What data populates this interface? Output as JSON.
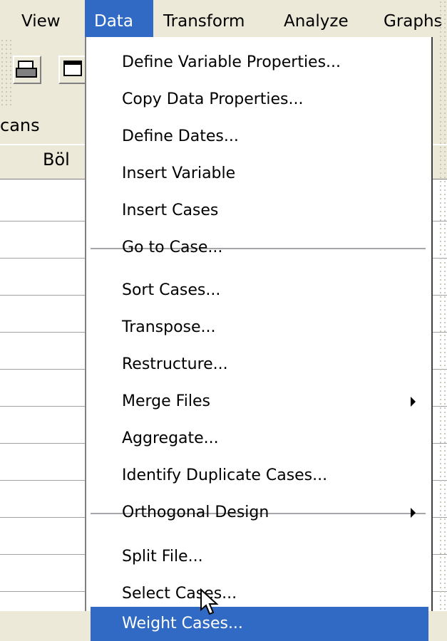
{
  "menubar": {
    "items": [
      {
        "label": "View"
      },
      {
        "label": "Data"
      },
      {
        "label": "Transform"
      },
      {
        "label": "Analyze"
      },
      {
        "label": "Graphs"
      }
    ],
    "active": "Data"
  },
  "background": {
    "row_label_partial": "cans",
    "column_header_partial": "Böl"
  },
  "menu": {
    "items": [
      {
        "label": "Define Variable Properties..."
      },
      {
        "label": "Copy Data Properties..."
      },
      {
        "label": "Define Dates..."
      },
      {
        "label": "Insert Variable"
      },
      {
        "label": "Insert Cases"
      },
      {
        "label": "Go to Case..."
      },
      {
        "label": "Sort Cases..."
      },
      {
        "label": "Transpose..."
      },
      {
        "label": "Restructure..."
      },
      {
        "label": "Merge Files",
        "submenu": true
      },
      {
        "label": "Aggregate..."
      },
      {
        "label": "Identify Duplicate Cases..."
      },
      {
        "label": "Orthogonal Design",
        "submenu": true
      },
      {
        "label": "Split File..."
      },
      {
        "label": "Select Cases..."
      },
      {
        "label": "Weight Cases...",
        "highlighted": true
      }
    ]
  },
  "colors": {
    "highlight": "#316ac5",
    "menu_bg": "#ffffff",
    "chrome": "#ece9d8"
  }
}
